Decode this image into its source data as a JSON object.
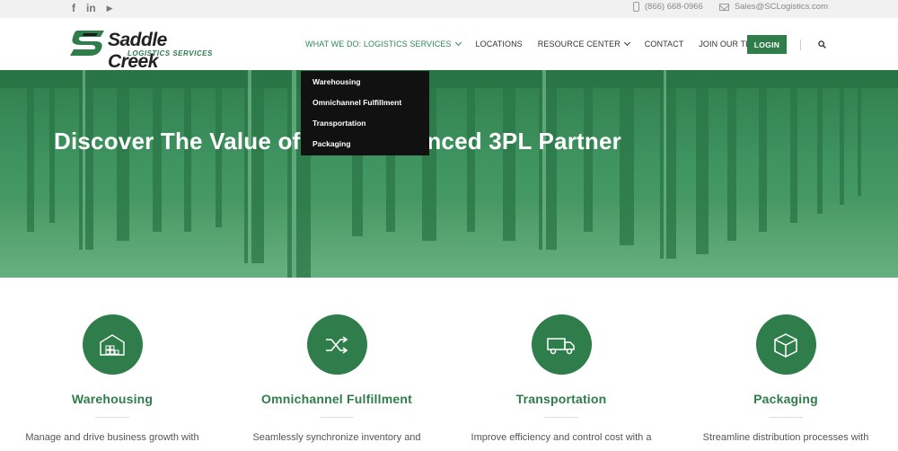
{
  "topbar": {
    "social": [
      {
        "icon": "facebook-icon",
        "glyph": "f"
      },
      {
        "icon": "linkedin-icon",
        "glyph": "in"
      },
      {
        "icon": "youtube-icon",
        "glyph": "▶"
      }
    ],
    "phone": "(866) 668-0966",
    "email": "Sales@SCLogistics.com"
  },
  "brand": {
    "name": "Saddle Creek",
    "tagline": "LOGISTICS SERVICES",
    "color": "#2f7d4a"
  },
  "nav": {
    "items": [
      {
        "label": "WHAT WE DO: LOGISTICS SERVICES",
        "has_dropdown": true,
        "active": true
      },
      {
        "label": "LOCATIONS",
        "has_dropdown": false
      },
      {
        "label": "RESOURCE CENTER",
        "has_dropdown": true
      },
      {
        "label": "CONTACT",
        "has_dropdown": false
      },
      {
        "label": "JOIN OUR TEAM",
        "has_dropdown": true
      }
    ],
    "login_label": "LOGIN",
    "search_icon": "search-icon"
  },
  "dropdown": {
    "items": [
      "Warehousing",
      "Omnichannel Fulfillment",
      "Transportation",
      "Packaging"
    ]
  },
  "hero": {
    "title": "Discover The Value of an Experienced 3PL Partner"
  },
  "services": [
    {
      "icon": "warehouse-icon",
      "title": "Warehousing",
      "desc": "Manage and drive business growth with"
    },
    {
      "icon": "shuffle-icon",
      "title": "Omnichannel Fulfillment",
      "desc": "Seamlessly synchronize inventory and"
    },
    {
      "icon": "truck-icon",
      "title": "Transportation",
      "desc": "Improve efficiency and control cost with a"
    },
    {
      "icon": "box-icon",
      "title": "Packaging",
      "desc": "Streamline distribution processes with"
    }
  ]
}
